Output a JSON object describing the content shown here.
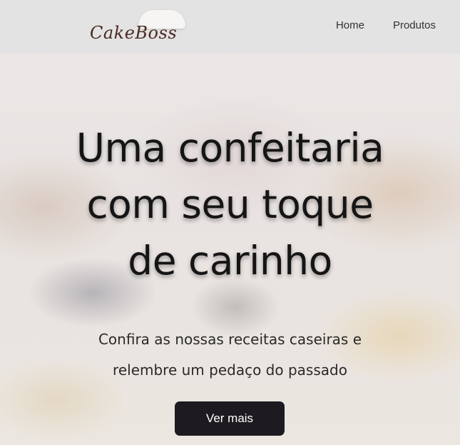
{
  "header": {
    "logo_text": "CakeBoss",
    "nav": {
      "home": "Home",
      "produtos": "Produtos"
    }
  },
  "hero": {
    "title_lines": [
      "Uma confeitaria",
      "com seu toque",
      "de carinho"
    ],
    "subtitle_lines": [
      "Confira as nossas receitas caseiras e",
      "relembre um pedaço do passado"
    ],
    "cta_label": "Ver mais"
  },
  "colors": {
    "navbar_bg": "#e3e3e3",
    "cta_bg": "#1e1b20",
    "logo_text": "#4a2a22",
    "title_text": "#151515"
  }
}
